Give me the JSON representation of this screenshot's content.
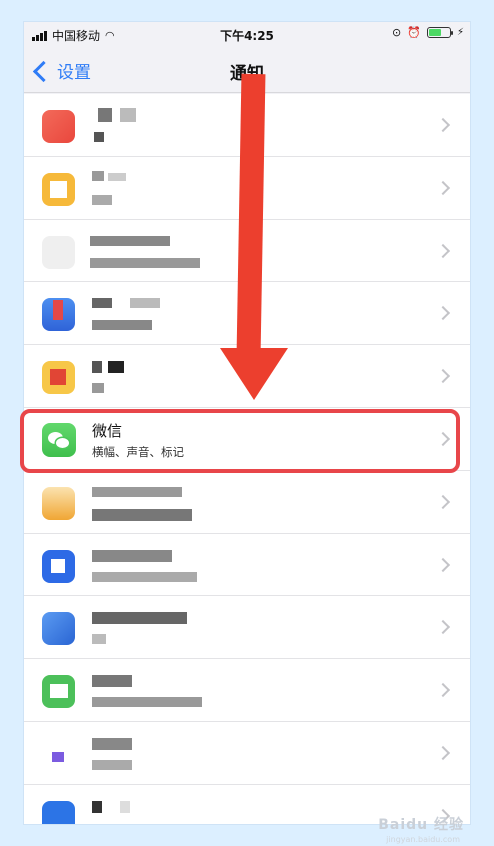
{
  "status": {
    "carrier": "中国移动",
    "time": "下午4:25"
  },
  "nav": {
    "back_label": "设置",
    "title": "通知"
  },
  "wechat": {
    "name": "微信",
    "subtitle": "横幅、声音、标记"
  },
  "watermark": {
    "text": "Baidu 经验",
    "url_text": "jingyan.baidu.com"
  },
  "colors": {
    "accent": "#2f7cf6",
    "highlight": "#e8464a",
    "arrow": "#ec3f2e",
    "wechat_green": "#4cc85a"
  }
}
